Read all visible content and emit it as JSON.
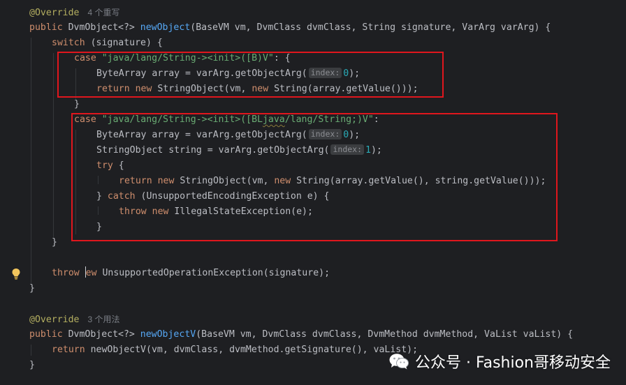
{
  "code": {
    "override_annotation": "@Override",
    "method1_usages": "4 个重写",
    "l_sig_1": "public DvmObject<?> ",
    "l_sig_name_1": "newObject",
    "l_sig_rest_1": "(BaseVM vm, DvmClass dvmClass, String signature, VarArg varArg) {",
    "l_switch": "switch",
    "l_switch_rest": " (signature) {",
    "l_case": "case",
    "l_case1_str": "\"java/lang/String-><init>([B)V\"",
    "l_colon_brace": ": {",
    "l_bytearray": "ByteArray array = varArg.getObjectArg(",
    "hint_index": "index:",
    "num_0": "0",
    "num_1": "1",
    "l_close_call": ");",
    "l_return": "return",
    "l_new": "new",
    "l_return1_rest": " StringObject(vm, ",
    "l_return1_rest2": " String(array.getValue()));",
    "l_brace_close": "}",
    "l_case2_str_a": "\"java/lang/String-><init>([BL",
    "l_case2_str_b": "java",
    "l_case2_str_c": "/lang/String;)V\"",
    "l_colon": ":",
    "l_stringobject": "StringObject string = varArg.getObjectArg(",
    "l_try": "try",
    "l_try_rest": " {",
    "l_return2_rest": " StringObject(vm, ",
    "l_return2_rest2": " String(array.getValue(), string.getValue()));",
    "l_close_brace_sp": "} ",
    "l_catch": "catch",
    "l_catch_rest": " (UnsupportedEncodingException e) {",
    "l_throw": "throw",
    "l_throw1_rest": " IllegalStateException(e);",
    "l_throw2_rest": " UnsupportedOperationException(signature);",
    "l_ne": "ew",
    "method2_usages": "3 个用法",
    "l_sig_name_2": "newObjectV",
    "l_sig_rest_2": "(BaseVM vm, DvmClass dvmClass, DvmMethod dvmMethod, VaList vaList) {",
    "l_return3_name": "newObjectV",
    "l_return3_rest": "(vm, dvmClass, dvmMethod.getSignature(), vaList);"
  },
  "watermark": {
    "text": "公众号 · Fashion哥移动安全"
  },
  "colors": {
    "background": "#1e1f22",
    "highlight_box": "#e0161d",
    "keyword": "#cf8e6d",
    "string": "#6aab73",
    "method": "#56a8f5",
    "annotation": "#b3ae60"
  },
  "icons": [
    "lightbulb-icon",
    "wechat-logo-icon"
  ]
}
